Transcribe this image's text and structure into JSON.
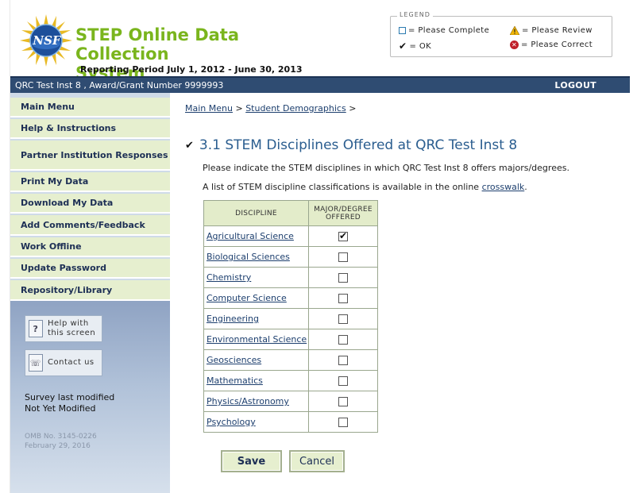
{
  "header": {
    "logo_text": "NSF",
    "title_line1": "STEP Online Data Collection",
    "title_line2": "System",
    "reporting_period": "Reporting Period July 1, 2012 - June 30, 2013"
  },
  "legend": {
    "title": "LEGEND",
    "complete": "= Please Complete",
    "review": "= Please Review",
    "ok": "= OK",
    "correct": "= Please Correct",
    "colors": {
      "review": "#f2b705",
      "correct": "#c0202a"
    }
  },
  "topbar": {
    "institution": "QRC Test Inst 8 , Award/Grant Number 9999993",
    "logout": "LOGOUT"
  },
  "sidebar": {
    "items": [
      {
        "label": "Main Menu"
      },
      {
        "label": "Help & Instructions"
      },
      {
        "label": "Partner Institution Responses"
      },
      {
        "label": "Print My Data"
      },
      {
        "label": "Download My Data"
      },
      {
        "label": "Add Comments/Feedback"
      },
      {
        "label": "Work Offline"
      },
      {
        "label": "Update Password"
      },
      {
        "label": "Repository/Library"
      }
    ],
    "help_button": {
      "line1": "Help with",
      "line2": "this screen",
      "icon": "?"
    },
    "contact_button": {
      "label": "Contact us",
      "icon": "☏"
    },
    "survey_modified_label": "Survey last modified",
    "survey_modified_value": "Not Yet Modified",
    "omb_line1": "OMB No. 3145-0226",
    "omb_line2": "February 29, 2016"
  },
  "main": {
    "breadcrumb": {
      "home": "Main Menu",
      "sep1": ">",
      "current": "Student Demographics",
      "sep2": ">"
    },
    "heading_check": "✔",
    "heading": "3.1 STEM Disciplines Offered at QRC Test Inst 8",
    "instruction1": "Please indicate the STEM disciplines in which QRC Test Inst 8 offers majors/degrees.",
    "instruction2_pre": "A list of STEM discipline classifications is available in the online ",
    "instruction2_link": "crosswalk",
    "instruction2_post": ".",
    "table": {
      "col_discipline": "DISCIPLINE",
      "col_offered_line1": "MAJOR/DEGREE",
      "col_offered_line2": "OFFERED",
      "rows": [
        {
          "name": "Agricultural Science",
          "checked": true
        },
        {
          "name": "Biological Sciences",
          "checked": false
        },
        {
          "name": "Chemistry",
          "checked": false
        },
        {
          "name": "Computer Science",
          "checked": false
        },
        {
          "name": "Engineering",
          "checked": false
        },
        {
          "name": "Environmental Science",
          "checked": false
        },
        {
          "name": "Geosciences",
          "checked": false
        },
        {
          "name": "Mathematics",
          "checked": false
        },
        {
          "name": "Physics/Astronomy",
          "checked": false
        },
        {
          "name": "Psychology",
          "checked": false
        }
      ]
    },
    "save_label": "Save",
    "cancel_label": "Cancel"
  }
}
